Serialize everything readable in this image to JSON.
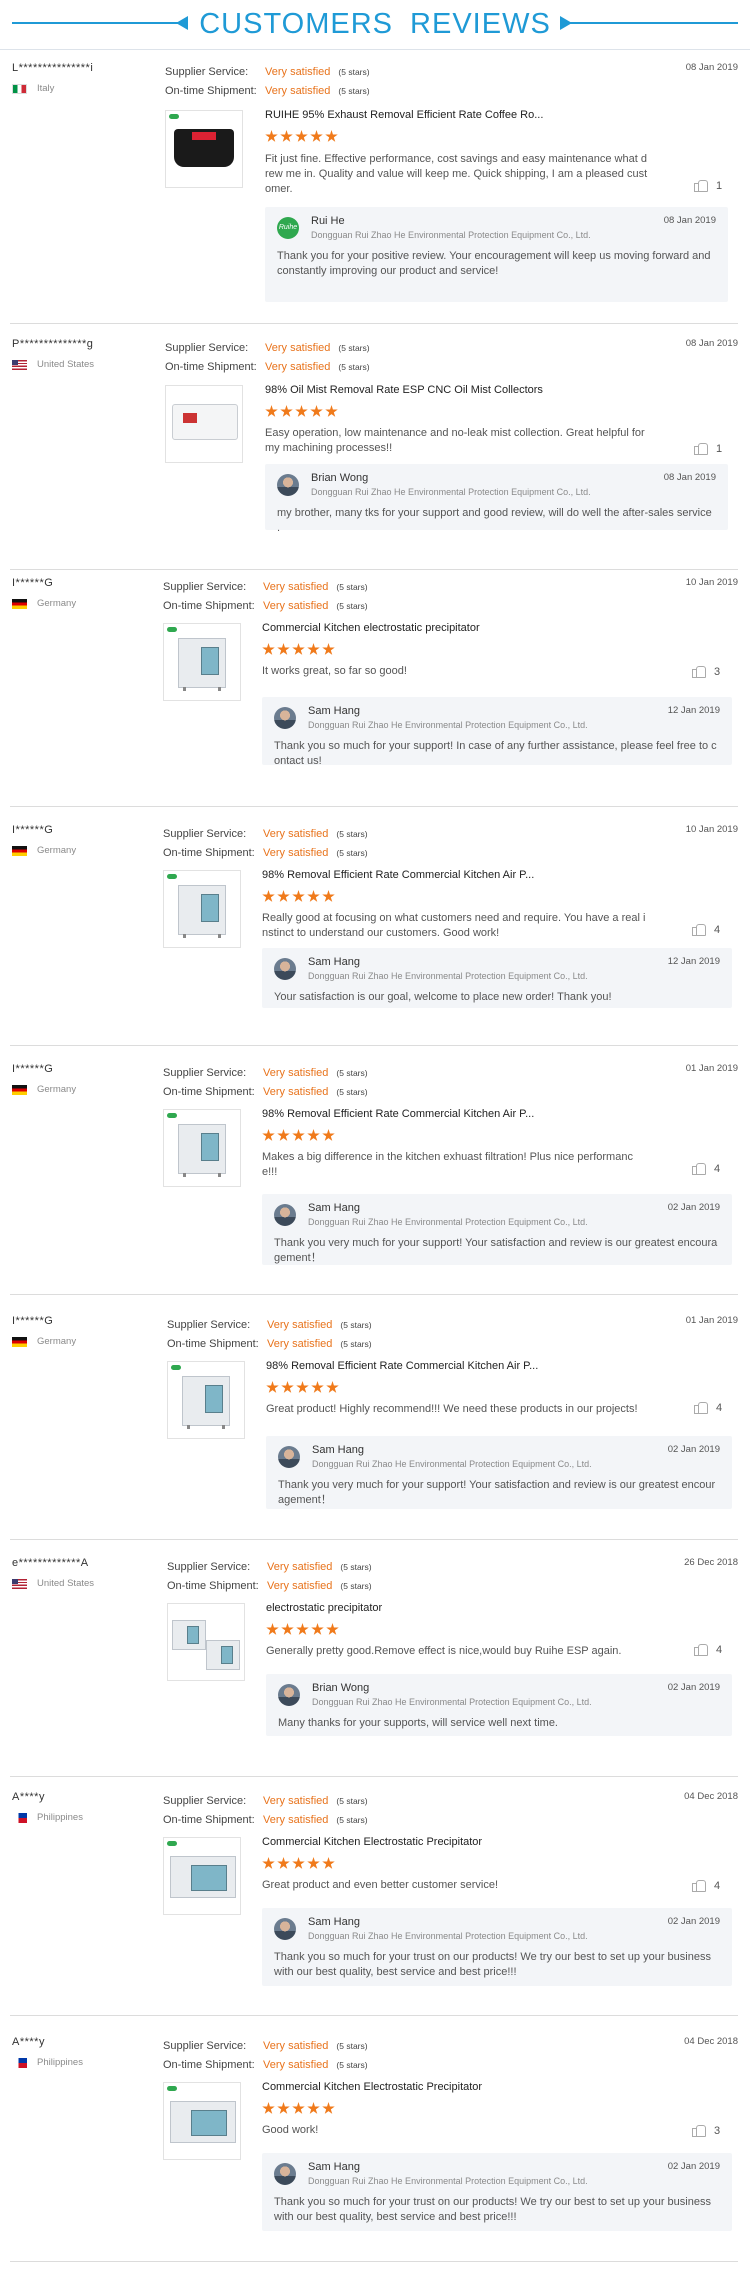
{
  "header": {
    "title": "CUSTOMERS   REVIEWS"
  },
  "labels": {
    "supplier_service": "Supplier Service:",
    "ontime_shipment": "On-time Shipment:",
    "very_satisfied": "Very satisfied",
    "five_stars": "(5 stars)"
  },
  "colors": {
    "accent": "#1f9ad6",
    "rating": "#e8731c",
    "star": "#f07a1b",
    "reply_bg": "#f3f5f8"
  },
  "company": "Dongguan Rui Zhao He Environmental Protection Equipment Co., Ltd.",
  "reviews": [
    {
      "user": "L***************i",
      "country": "Italy",
      "flag": "it",
      "date": "08 Jan 2019",
      "product": "RUIHE 95% Exhaust Removal Efficient Rate Coffee Ro...",
      "product_image": "black-exhaust-unit",
      "stars": 5,
      "comment": "Fit just fine. Effective performance, cost savings and easy maintenance what drew me in. Quality and value will keep me. Quick shipping, I am a pleased customer.",
      "likes": "1",
      "reply": {
        "name": "Rui He",
        "avatar": "ruihe-logo",
        "date": "08 Jan 2019",
        "text": "Thank you for your positive review. Your encouragement will keep us moving forward and constantly improving our product and service!"
      }
    },
    {
      "user": "P**************g",
      "country": "United States",
      "flag": "us",
      "date": "08 Jan 2019",
      "product": "98% Oil Mist Removal Rate ESP CNC Oil Mist Collectors",
      "product_image": "white-oil-mist-collector",
      "stars": 5,
      "comment": "Easy operation, low maintenance and no-leak mist collection. Great helpful for my machining processes!!",
      "likes": "1",
      "reply": {
        "name": "Brian Wong",
        "avatar": "person",
        "date": "08 Jan 2019",
        "text": "my brother, many tks for your support and good review, will do well the after-sales service ."
      }
    },
    {
      "user": "I******G",
      "country": "Germany",
      "flag": "de",
      "date": "10 Jan 2019",
      "product": "Commercial Kitchen electrostatic precipitator",
      "product_image": "esp-cabinet",
      "stars": 5,
      "comment": "It works great, so far so good!",
      "likes": "3",
      "reply": {
        "name": "Sam Hang",
        "avatar": "person",
        "date": "12 Jan 2019",
        "text": "Thank you so much for your support! In case of any further assistance, please feel free to contact us!"
      }
    },
    {
      "user": "I******G",
      "country": "Germany",
      "flag": "de",
      "date": "10 Jan 2019",
      "product": "98% Removal Efficient Rate Commercial Kitchen Air P...",
      "product_image": "esp-cabinet",
      "stars": 5,
      "comment": "Really good at focusing on what customers need and require. You have a real instinct to understand our customers. Good work!",
      "likes": "4",
      "reply": {
        "name": "Sam Hang",
        "avatar": "person",
        "date": "12 Jan 2019",
        "text": "Your satisfaction is our goal, welcome to place new order! Thank you!"
      }
    },
    {
      "user": "I******G",
      "country": "Germany",
      "flag": "de",
      "date": "01 Jan 2019",
      "product": "98% Removal Efficient Rate Commercial Kitchen Air P...",
      "product_image": "esp-cabinet",
      "stars": 5,
      "comment": "Makes a big difference in the kitchen exhuast filtration! Plus nice performance!!!",
      "likes": "4",
      "reply": {
        "name": "Sam Hang",
        "avatar": "person",
        "date": "02 Jan 2019",
        "text": "Thank you very much for your support! Your satisfaction and review is our greatest encouragement！"
      }
    },
    {
      "user": "I******G",
      "country": "Germany",
      "flag": "de",
      "date": "01 Jan 2019",
      "product": "98% Removal Efficient Rate Commercial Kitchen Air P...",
      "product_image": "esp-cabinet",
      "stars": 5,
      "comment": "Great product! Highly recommend!!! We need these products in our projects!",
      "likes": "4",
      "reply": {
        "name": "Sam Hang",
        "avatar": "person",
        "date": "02 Jan 2019",
        "text": "Thank you very much for your support! Your satisfaction and review is our greatest encouragement！"
      }
    },
    {
      "user": "e*************A",
      "country": "United States",
      "flag": "us",
      "date": "26 Dec 2018",
      "product": "electrostatic precipitator",
      "product_image": "esp-modules",
      "stars": 5,
      "comment": "Generally pretty good.Remove effect is nice,would buy Ruihe ESP again.",
      "likes": "4",
      "reply": {
        "name": "Brian Wong",
        "avatar": "person",
        "date": "02 Jan 2019",
        "text": "Many thanks for your supports, will service well next time."
      }
    },
    {
      "user": "A****y",
      "country": "Philippines",
      "flag": "ph",
      "date": "04 Dec 2018",
      "product": "Commercial Kitchen Electrostatic Precipitator",
      "product_image": "esp-wide",
      "stars": 5,
      "comment": "Great product and even better customer service!",
      "likes": "4",
      "reply": {
        "name": "Sam Hang",
        "avatar": "person",
        "date": "02 Jan 2019",
        "text": "Thank you so much for your trust on our products! We try our best to set up your business with our best quality, best service and best price!!!"
      }
    },
    {
      "user": "A****y",
      "country": "Philippines",
      "flag": "ph",
      "date": "04 Dec 2018",
      "product": "Commercial Kitchen Electrostatic Precipitator",
      "product_image": "esp-wide",
      "stars": 5,
      "comment": "Good work!",
      "likes": "3",
      "reply": {
        "name": "Sam Hang",
        "avatar": "person",
        "date": "02 Jan 2019",
        "text": "Thank you so much for your trust on our products! We try our best to set up your business with our best quality, best service and best price!!!"
      }
    }
  ]
}
